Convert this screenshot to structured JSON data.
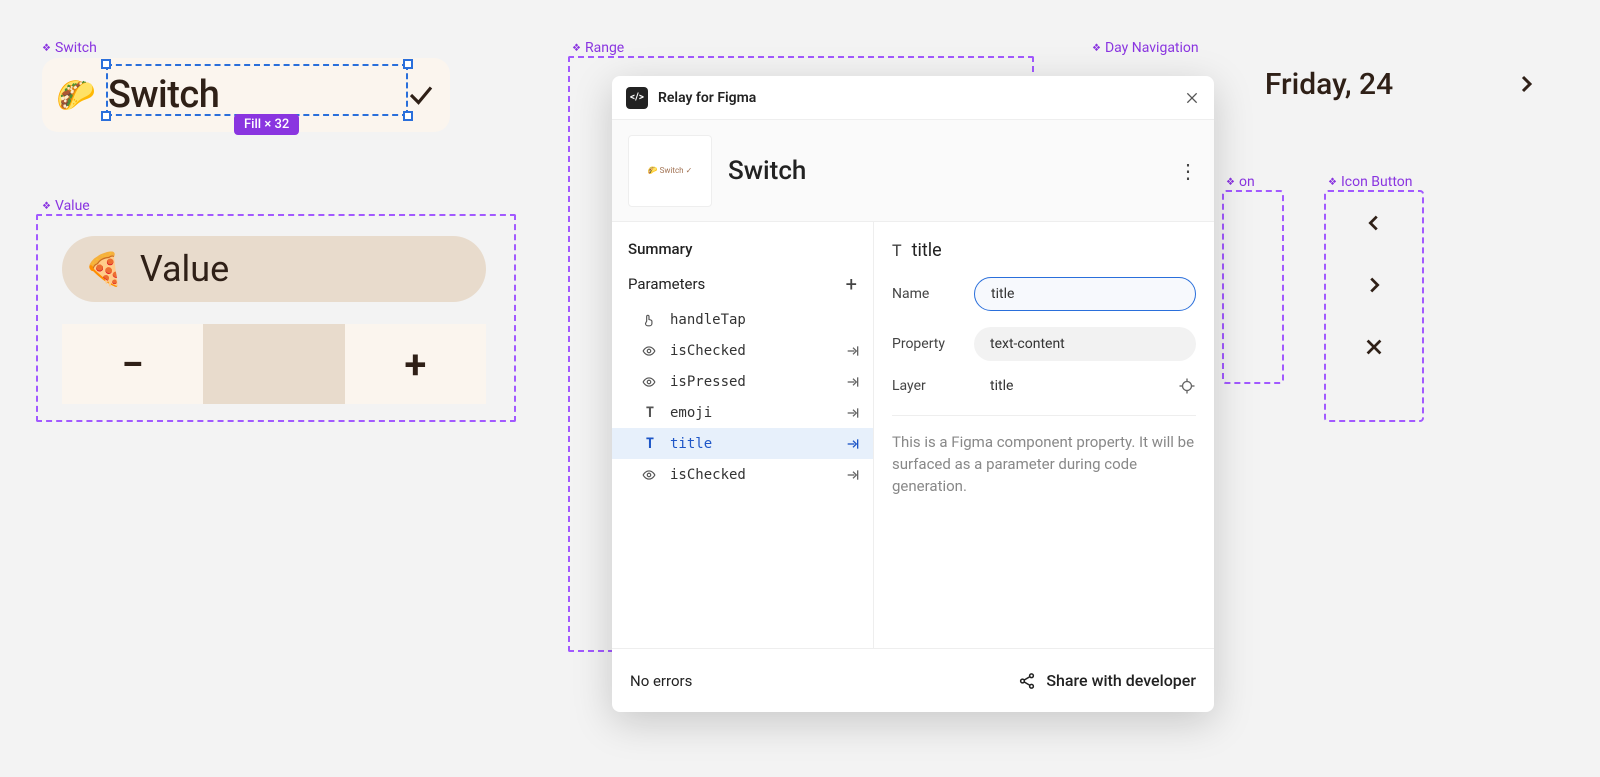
{
  "canvas": {
    "switch": {
      "label": "Switch",
      "emoji": "🌮",
      "title": "Switch",
      "selection_badge": "Fill × 32"
    },
    "value": {
      "label": "Value",
      "emoji": "🍕",
      "title": "Value",
      "minus": "−",
      "plus": "+"
    },
    "range": {
      "label": "Range"
    },
    "day_nav": {
      "label": "Day Navigation",
      "date": "Friday, 24"
    },
    "icon_button_a": {
      "label": "on"
    },
    "icon_button_b": {
      "label": "Icon Button"
    }
  },
  "relay": {
    "header_title": "Relay for Figma",
    "component_name": "Switch",
    "thumb_text": "🌮 Switch  ✓",
    "summary_label": "Summary",
    "parameters_label": "Parameters",
    "parameters": [
      {
        "name": "handleTap",
        "icon": "tap",
        "arrow": false
      },
      {
        "name": "isChecked",
        "icon": "eye",
        "arrow": true
      },
      {
        "name": "isPressed",
        "icon": "eye",
        "arrow": true
      },
      {
        "name": "emoji",
        "icon": "text",
        "arrow": true
      },
      {
        "name": "title",
        "icon": "text",
        "arrow": true,
        "selected": true
      },
      {
        "name": "isChecked",
        "icon": "eye",
        "arrow": true
      }
    ],
    "detail": {
      "heading": "title",
      "name_label": "Name",
      "name_value": "title",
      "property_label": "Property",
      "property_value": "text-content",
      "layer_label": "Layer",
      "layer_value": "title",
      "description": "This is a Figma component property. It will be surfaced as a parameter during code generation."
    },
    "footer": {
      "status": "No errors",
      "share": "Share with developer"
    }
  }
}
